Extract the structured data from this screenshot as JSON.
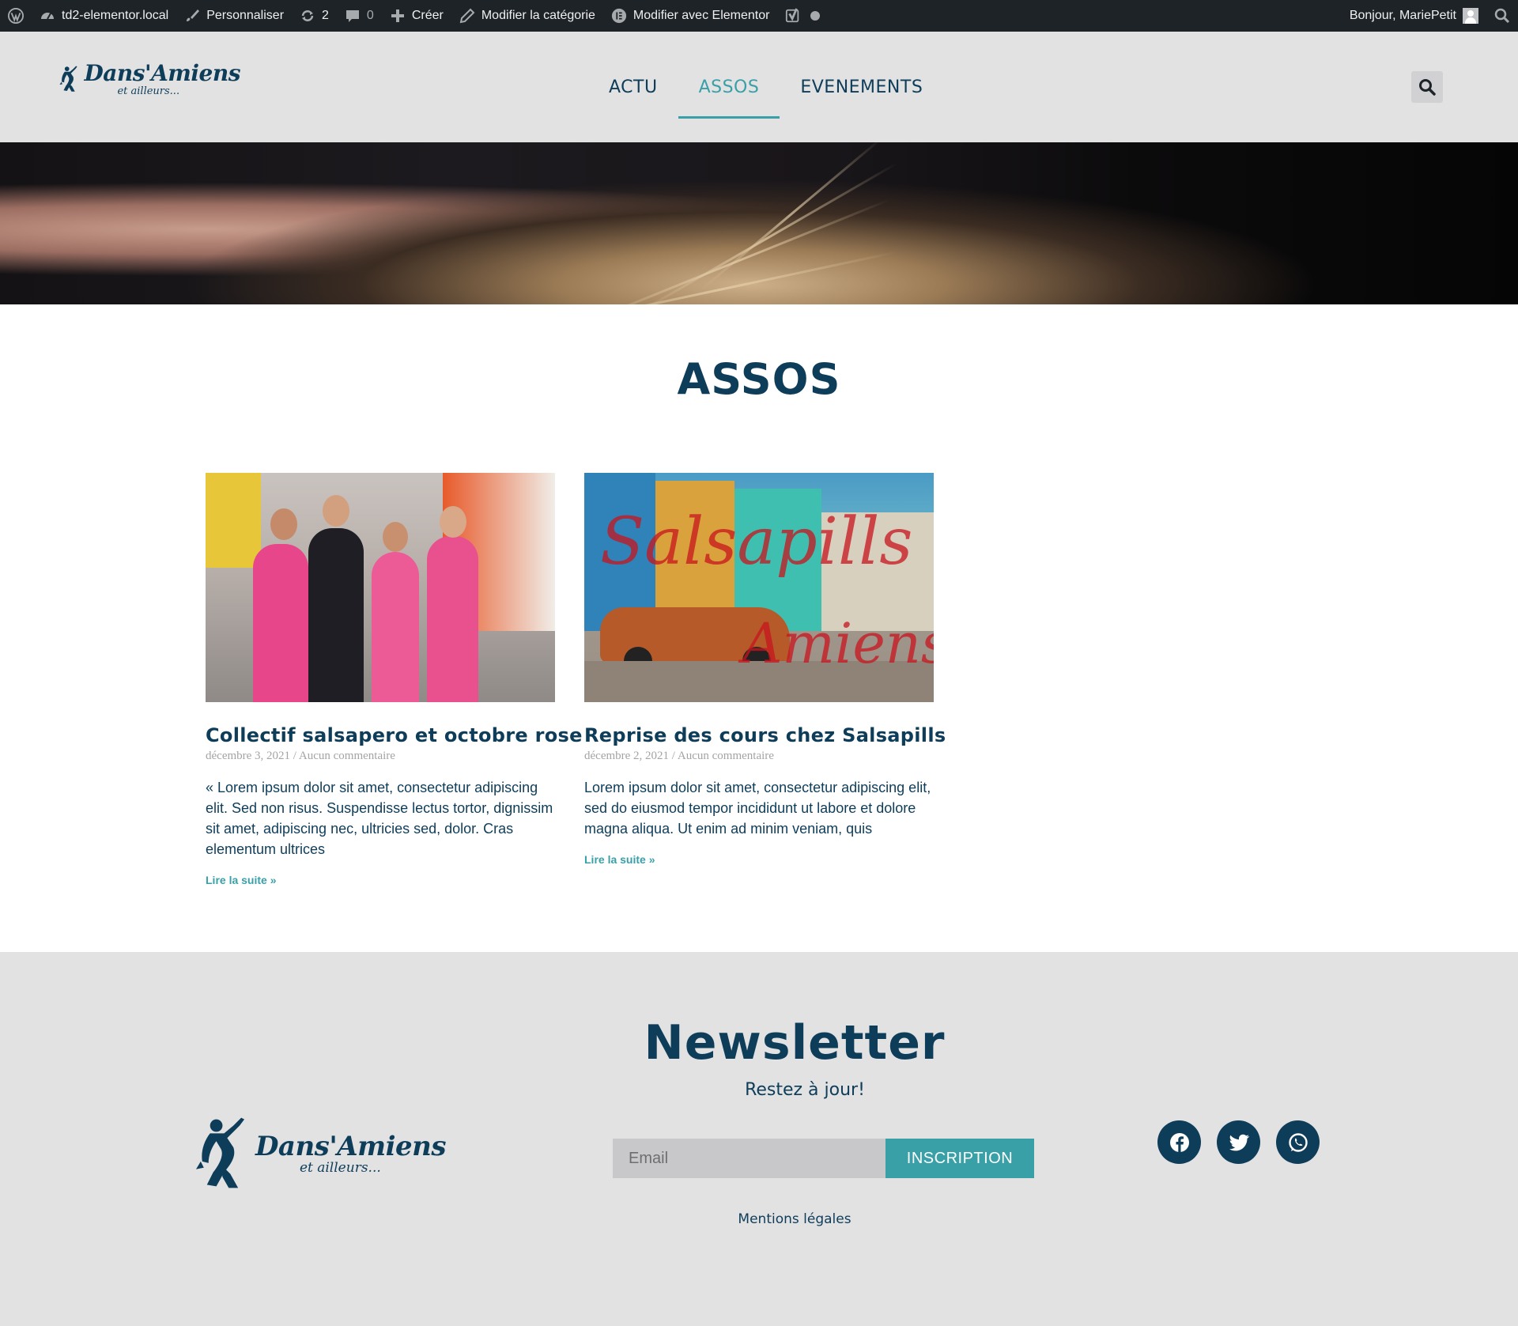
{
  "admin_bar": {
    "site_name": "td2-elementor.local",
    "customize": "Personnaliser",
    "updates_count": "2",
    "comments_count": "0",
    "new": "Créer",
    "edit_category": "Modifier la catégorie",
    "edit_elementor": "Modifier avec Elementor",
    "greeting": "Bonjour, MariePetit"
  },
  "header": {
    "logo_main": "Dans'Amiens",
    "logo_sub": "et ailleurs...",
    "nav": [
      {
        "label": "ACTU",
        "active": false
      },
      {
        "label": "ASSOS",
        "active": true
      },
      {
        "label": "EVENEMENTS",
        "active": false
      }
    ]
  },
  "main": {
    "page_title": "ASSOS",
    "posts": [
      {
        "title": "Collectif salsapero et octobre rose",
        "date": "décembre 3, 2021",
        "comments": "Aucun commentaire",
        "excerpt": "« Lorem ipsum dolor sit amet, consectetur adipiscing elit. Sed non risus. Suspendisse lectus tortor, dignissim sit amet, adipiscing nec, ultricies sed, dolor. Cras elementum ultrices",
        "read_more": "Lire la suite »"
      },
      {
        "title": "Reprise des cours chez Salsapills",
        "date": "décembre 2, 2021",
        "comments": "Aucun commentaire",
        "excerpt": "Lorem ipsum dolor sit amet, consectetur adipiscing elit, sed do eiusmod tempor incididunt ut labore et dolore magna aliqua. Ut enim ad minim veniam, quis",
        "read_more": "Lire la suite »",
        "image_overlay": {
          "word1": "Salsapills",
          "word2": "Amiens"
        }
      }
    ]
  },
  "footer": {
    "newsletter_title": "Newsletter",
    "newsletter_sub": "Restez à jour!",
    "email_placeholder": "Email",
    "subscribe_label": "INSCRIPTION",
    "legal": "Mentions légales",
    "logo_main": "Dans'Amiens",
    "logo_sub": "et ailleurs...",
    "socials": [
      "facebook-icon",
      "twitter-icon",
      "whatsapp-icon"
    ]
  },
  "colors": {
    "brand_dark": "#0e3d5a",
    "accent": "#3aa0a8",
    "header_bg": "#e2e2e3",
    "admin_bar_bg": "#1d2327"
  }
}
